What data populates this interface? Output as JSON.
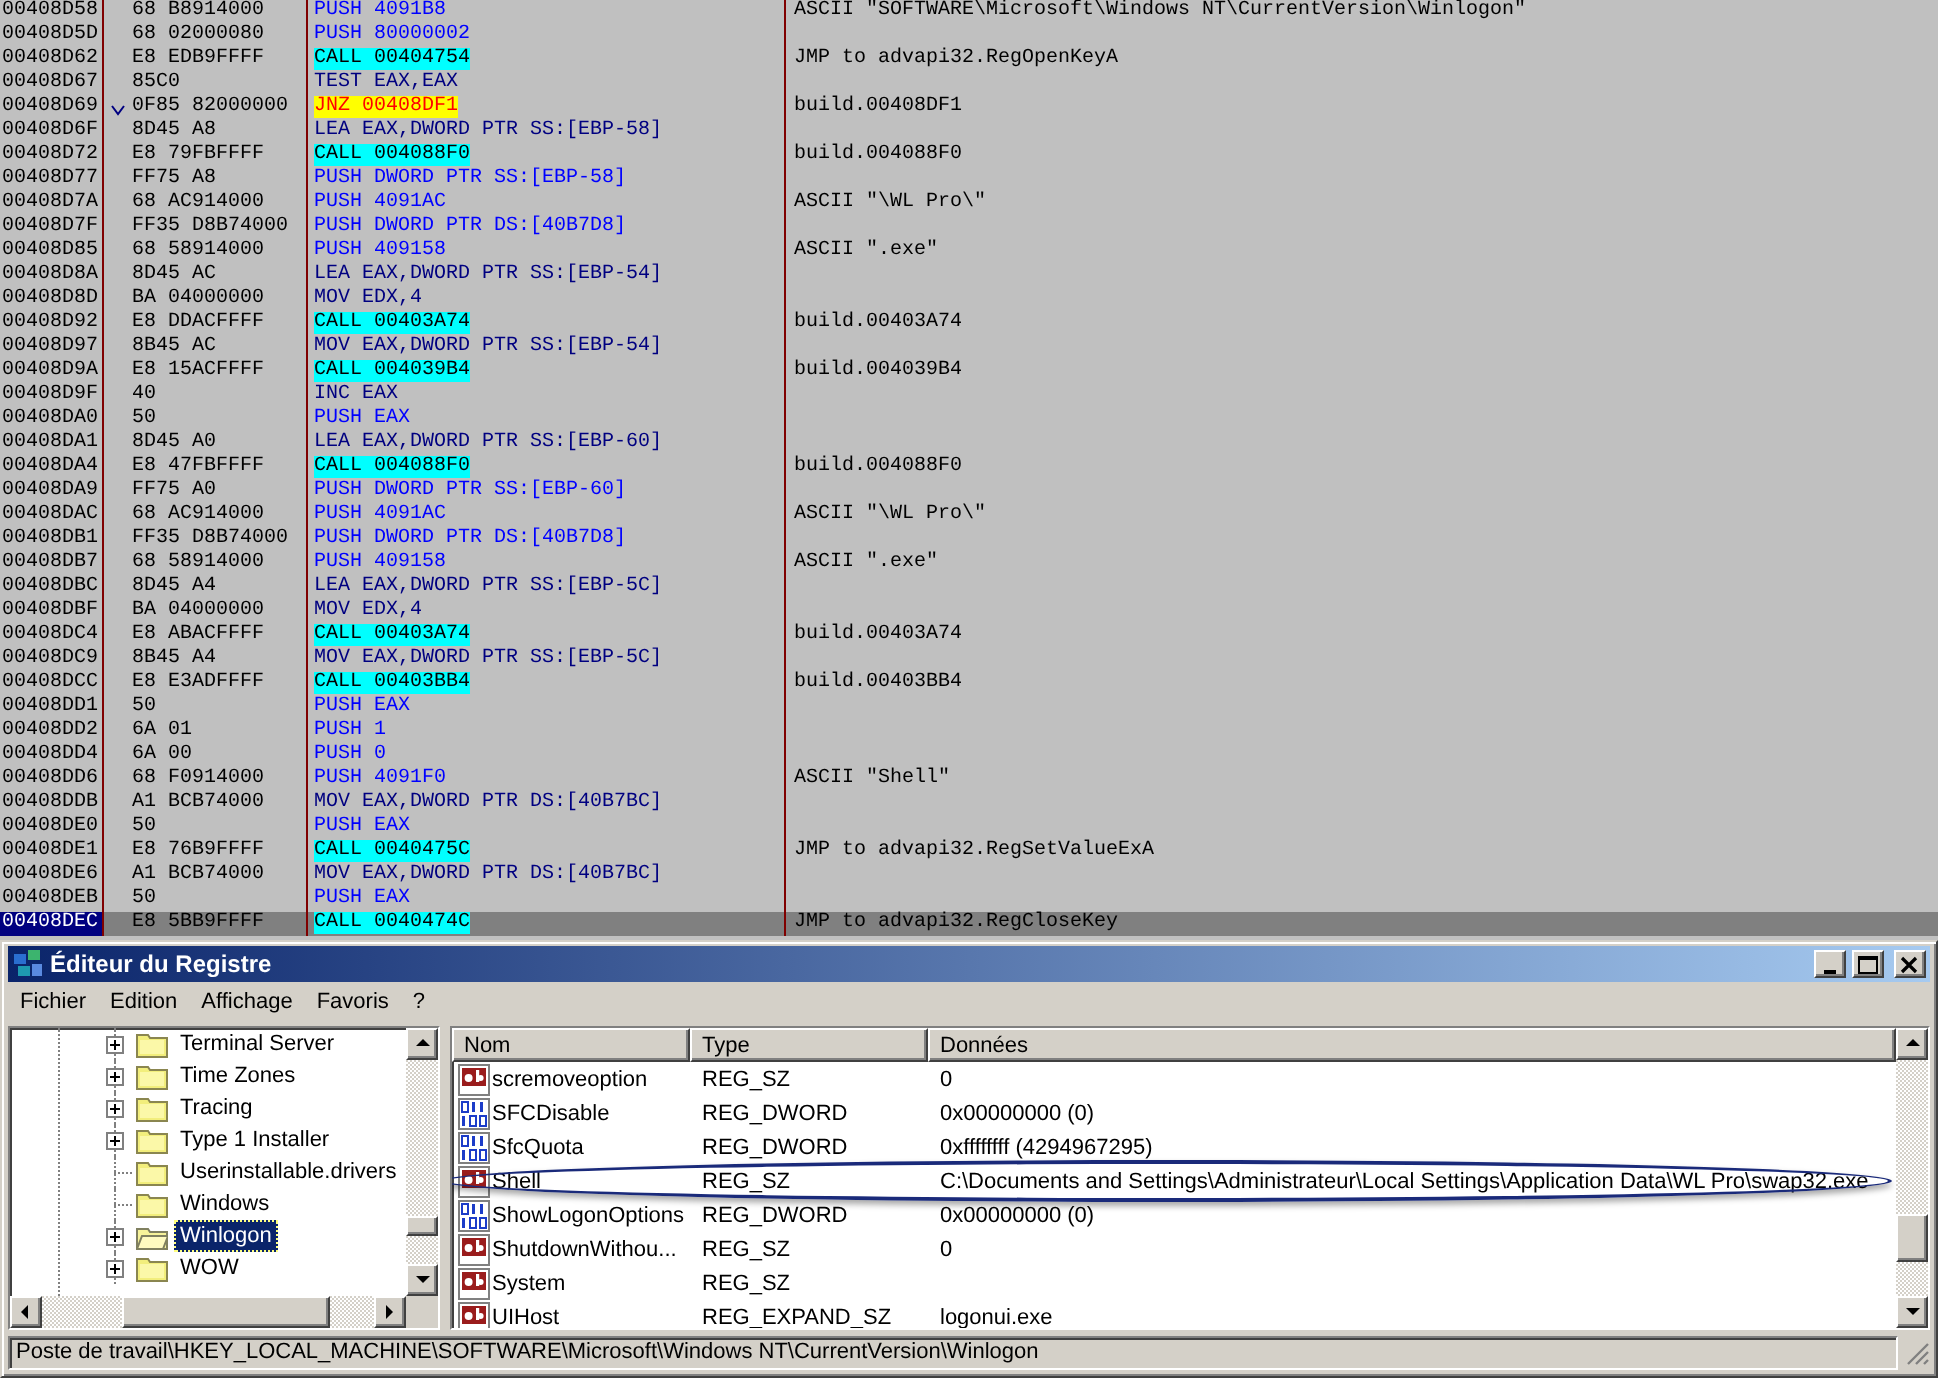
{
  "disassembly": {
    "rows": [
      {
        "address": "00408D58",
        "hex": "68 B8914000",
        "instruction": "PUSH 4091B8",
        "kind": "push",
        "comment": "ASCII \"SOFTWARE\\Microsoft\\Windows NT\\CurrentVersion\\Winlogon\"",
        "selected": false
      },
      {
        "address": "00408D5D",
        "hex": "68 02000080",
        "instruction": "PUSH 80000002",
        "kind": "push",
        "selected": false
      },
      {
        "address": "00408D62",
        "hex": "E8 EDB9FFFF",
        "instruction": "CALL 00404754",
        "kind": "call",
        "comment": "JMP to advapi32.RegOpenKeyA",
        "selected": false
      },
      {
        "address": "00408D67",
        "hex": "85C0",
        "instruction": "TEST EAX,EAX",
        "kind": "plain",
        "selected": false
      },
      {
        "address": "00408D69",
        "hex": "0F85 82000000",
        "instruction": "JNZ 00408DF1",
        "kind": "jump",
        "comment": "build.00408DF1",
        "selected": false
      },
      {
        "address": "00408D6F",
        "hex": "8D45 A8",
        "instruction": "LEA EAX,DWORD PTR SS:[EBP-58]",
        "kind": "plain",
        "selected": false
      },
      {
        "address": "00408D72",
        "hex": "E8 79FBFFFF",
        "instruction": "CALL 004088F0",
        "kind": "call",
        "comment": "build.004088F0",
        "selected": false
      },
      {
        "address": "00408D77",
        "hex": "FF75 A8",
        "instruction": "PUSH DWORD PTR SS:[EBP-58]",
        "kind": "push",
        "selected": false
      },
      {
        "address": "00408D7A",
        "hex": "68 AC914000",
        "instruction": "PUSH 4091AC",
        "kind": "push",
        "comment": "ASCII \"\\WL Pro\\\"",
        "selected": false
      },
      {
        "address": "00408D7F",
        "hex": "FF35 D8B74000",
        "instruction": "PUSH DWORD PTR DS:[40B7D8]",
        "kind": "push",
        "selected": false
      },
      {
        "address": "00408D85",
        "hex": "68 58914000",
        "instruction": "PUSH 409158",
        "kind": "push",
        "comment": "ASCII \".exe\"",
        "selected": false
      },
      {
        "address": "00408D8A",
        "hex": "8D45 AC",
        "instruction": "LEA EAX,DWORD PTR SS:[EBP-54]",
        "kind": "plain",
        "selected": false
      },
      {
        "address": "00408D8D",
        "hex": "BA 04000000",
        "instruction": "MOV EDX,4",
        "kind": "plain",
        "selected": false
      },
      {
        "address": "00408D92",
        "hex": "E8 DDACFFFF",
        "instruction": "CALL 00403A74",
        "kind": "call",
        "comment": "build.00403A74",
        "selected": false
      },
      {
        "address": "00408D97",
        "hex": "8B45 AC",
        "instruction": "MOV EAX,DWORD PTR SS:[EBP-54]",
        "kind": "plain",
        "selected": false
      },
      {
        "address": "00408D9A",
        "hex": "E8 15ACFFFF",
        "instruction": "CALL 004039B4",
        "kind": "call",
        "comment": "build.004039B4",
        "selected": false
      },
      {
        "address": "00408D9F",
        "hex": "40",
        "instruction": "INC EAX",
        "kind": "plain",
        "selected": false
      },
      {
        "address": "00408DA0",
        "hex": "50",
        "instruction": "PUSH EAX",
        "kind": "push",
        "selected": false
      },
      {
        "address": "00408DA1",
        "hex": "8D45 A0",
        "instruction": "LEA EAX,DWORD PTR SS:[EBP-60]",
        "kind": "plain",
        "selected": false
      },
      {
        "address": "00408DA4",
        "hex": "E8 47FBFFFF",
        "instruction": "CALL 004088F0",
        "kind": "call",
        "comment": "build.004088F0",
        "selected": false
      },
      {
        "address": "00408DA9",
        "hex": "FF75 A0",
        "instruction": "PUSH DWORD PTR SS:[EBP-60]",
        "kind": "push",
        "selected": false
      },
      {
        "address": "00408DAC",
        "hex": "68 AC914000",
        "instruction": "PUSH 4091AC",
        "kind": "push",
        "comment": "ASCII \"\\WL Pro\\\"",
        "selected": false
      },
      {
        "address": "00408DB1",
        "hex": "FF35 D8B74000",
        "instruction": "PUSH DWORD PTR DS:[40B7D8]",
        "kind": "push",
        "selected": false
      },
      {
        "address": "00408DB7",
        "hex": "68 58914000",
        "instruction": "PUSH 409158",
        "kind": "push",
        "comment": "ASCII \".exe\"",
        "selected": false
      },
      {
        "address": "00408DBC",
        "hex": "8D45 A4",
        "instruction": "LEA EAX,DWORD PTR SS:[EBP-5C]",
        "kind": "plain",
        "selected": false
      },
      {
        "address": "00408DBF",
        "hex": "BA 04000000",
        "instruction": "MOV EDX,4",
        "kind": "plain",
        "selected": false
      },
      {
        "address": "00408DC4",
        "hex": "E8 ABACFFFF",
        "instruction": "CALL 00403A74",
        "kind": "call",
        "comment": "build.00403A74",
        "selected": false
      },
      {
        "address": "00408DC9",
        "hex": "8B45 A4",
        "instruction": "MOV EAX,DWORD PTR SS:[EBP-5C]",
        "kind": "plain",
        "selected": false
      },
      {
        "address": "00408DCC",
        "hex": "E8 E3ADFFFF",
        "instruction": "CALL 00403BB4",
        "kind": "call",
        "comment": "build.00403BB4",
        "selected": false
      },
      {
        "address": "00408DD1",
        "hex": "50",
        "instruction": "PUSH EAX",
        "kind": "push",
        "selected": false
      },
      {
        "address": "00408DD2",
        "hex": "6A 01",
        "instruction": "PUSH 1",
        "kind": "push",
        "selected": false
      },
      {
        "address": "00408DD4",
        "hex": "6A 00",
        "instruction": "PUSH 0",
        "kind": "push",
        "selected": false
      },
      {
        "address": "00408DD6",
        "hex": "68 F0914000",
        "instruction": "PUSH 4091F0",
        "kind": "push",
        "comment": "ASCII \"Shell\"",
        "selected": false
      },
      {
        "address": "00408DDB",
        "hex": "A1 BCB74000",
        "instruction": "MOV EAX,DWORD PTR DS:[40B7BC]",
        "kind": "plain",
        "selected": false
      },
      {
        "address": "00408DE0",
        "hex": "50",
        "instruction": "PUSH EAX",
        "kind": "push",
        "selected": false
      },
      {
        "address": "00408DE1",
        "hex": "E8 76B9FFFF",
        "instruction": "CALL 0040475C",
        "kind": "call",
        "comment": "JMP to advapi32.RegSetValueExA",
        "selected": false
      },
      {
        "address": "00408DE6",
        "hex": "A1 BCB74000",
        "instruction": "MOV EAX,DWORD PTR DS:[40B7BC]",
        "kind": "plain",
        "selected": false
      },
      {
        "address": "00408DEB",
        "hex": "50",
        "instruction": "PUSH EAX",
        "kind": "push",
        "selected": false
      },
      {
        "address": "00408DEC",
        "hex": "E8 5BB9FFFF",
        "instruction": "CALL 0040474C",
        "kind": "call",
        "comment": "JMP to advapi32.RegCloseKey",
        "selected": true
      }
    ]
  },
  "registry_editor": {
    "title": "Éditeur du Registre",
    "menu": [
      "Fichier",
      "Edition",
      "Affichage",
      "Favoris",
      "?"
    ],
    "tree": [
      {
        "label": "Terminal Server",
        "has_children": true,
        "selected": false
      },
      {
        "label": "Time Zones",
        "has_children": true,
        "selected": false
      },
      {
        "label": "Tracing",
        "has_children": true,
        "selected": false
      },
      {
        "label": "Type 1 Installer",
        "has_children": true,
        "selected": false
      },
      {
        "label": "Userinstallable.drivers",
        "has_children": false,
        "selected": false
      },
      {
        "label": "Windows",
        "has_children": false,
        "selected": false
      },
      {
        "label": "Winlogon",
        "has_children": true,
        "selected": true
      },
      {
        "label": "WOW",
        "has_children": true,
        "selected": false
      }
    ],
    "columns": [
      "Nom",
      "Type",
      "Données"
    ],
    "values": [
      {
        "name": "scremoveoption",
        "type": "REG_SZ",
        "data": "0",
        "kind": "string",
        "circled": false
      },
      {
        "name": "SFCDisable",
        "type": "REG_DWORD",
        "data": "0x00000000 (0)",
        "kind": "binary",
        "circled": false
      },
      {
        "name": "SfcQuota",
        "type": "REG_DWORD",
        "data": "0xffffffff (4294967295)",
        "kind": "binary",
        "circled": false
      },
      {
        "name": "Shell",
        "type": "REG_SZ",
        "data": "C:\\Documents and Settings\\Administrateur\\Local Settings\\Application Data\\WL Pro\\swap32.exe",
        "kind": "string",
        "circled": true
      },
      {
        "name": "ShowLogonOptions",
        "type": "REG_DWORD",
        "data": "0x00000000 (0)",
        "kind": "binary",
        "circled": false
      },
      {
        "name": "ShutdownWithou...",
        "type": "REG_SZ",
        "data": "0",
        "kind": "string",
        "circled": false
      },
      {
        "name": "System",
        "type": "REG_SZ",
        "kind": "string",
        "circled": false
      },
      {
        "name": "UIHost",
        "type": "REG_EXPAND_SZ",
        "data": "logonui.exe",
        "kind": "string",
        "circled": false
      }
    ],
    "status_bar": "Poste de travail\\HKEY_LOCAL_MACHINE\\SOFTWARE\\Microsoft\\Windows NT\\CurrentVersion\\Winlogon"
  }
}
